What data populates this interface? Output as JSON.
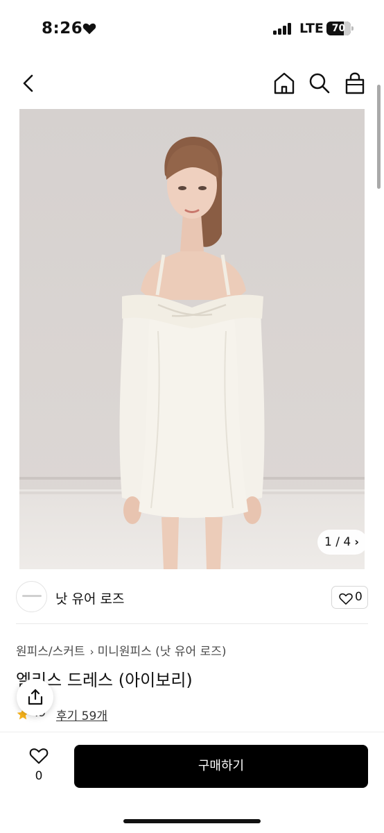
{
  "status_bar": {
    "time": "8:26",
    "network": "LTE",
    "battery_percent": "70",
    "battery_level": 0.7,
    "signal_bars": 4,
    "icons": [
      "heart-icon",
      "signal-icon",
      "battery-icon"
    ]
  },
  "nav": {
    "icons": [
      "back-arrow-icon",
      "home-icon",
      "search-icon",
      "shopping-bag-icon"
    ]
  },
  "gallery": {
    "current": "1",
    "total": "4",
    "counter": "1 / 4",
    "next_icon": "chevron-right-icon"
  },
  "brand": {
    "name": "낫 유어 로즈",
    "like_count": "0",
    "like_icon": "heart-outline-icon"
  },
  "product": {
    "breadcrumb": [
      "원피스/스커트",
      "미니원피스 (낫 유어 로즈)"
    ],
    "breadcrumb_separator_icon": "chevron-right-icon",
    "title": "엘리스 드레스 (아이보리)",
    "rating_score": ".9",
    "review_link": "후기 59개",
    "star_icon": "star-icon",
    "share_icon": "share-icon"
  },
  "bottom_bar": {
    "like_count": "0",
    "like_icon": "heart-outline-icon",
    "buy_label": "구매하기"
  },
  "colors": {
    "accent": "#000000",
    "star": "#f6b21b",
    "image_background": "#dad5d2"
  }
}
